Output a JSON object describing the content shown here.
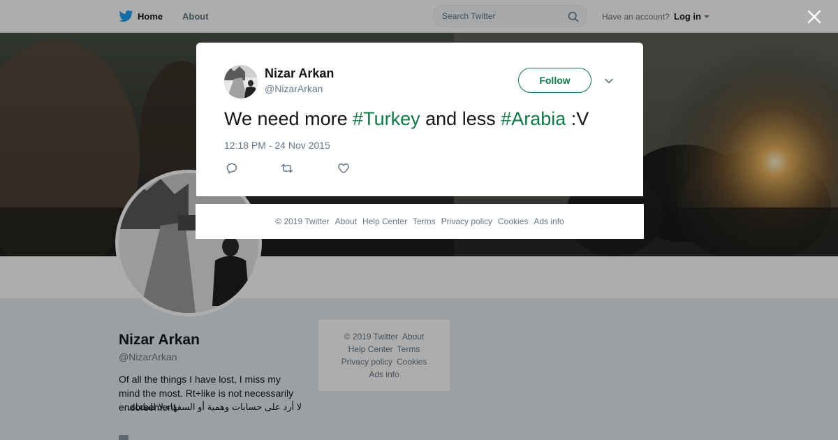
{
  "nav": {
    "home_label": "Home",
    "about_label": "About",
    "search_placeholder": "Search Twitter",
    "have_account": "Have an account?",
    "login_label": "Log in"
  },
  "profile": {
    "name": "Nizar Arkan",
    "handle": "@NizarArkan",
    "bio": "Of all the things I have lost, I miss my mind the most. Rt+like is not necessarily endorsement.",
    "bio_arabic": "لا أرد على حسابات وهمية أو السفهاء.لا للطغاة."
  },
  "side_footer": {
    "copyright": "© 2019 Twitter",
    "about": "About",
    "help_center": "Help Center",
    "terms": "Terms",
    "privacy": "Privacy policy",
    "cookies": "Cookies",
    "ads_info": "Ads info"
  },
  "tweet": {
    "author_name": "Nizar Arkan",
    "author_handle": "@NizarArkan",
    "follow_label": "Follow",
    "text_part1": "We need more ",
    "hashtag1": "#Turkey",
    "text_part2": " and less ",
    "hashtag2": "#Arabia",
    "text_part3": " :V",
    "timestamp": "12:18 PM - 24 Nov 2015"
  },
  "modal_footer": {
    "copyright": "© 2019 Twitter",
    "about": "About",
    "help_center": "Help Center",
    "terms": "Terms",
    "privacy": "Privacy policy",
    "cookies": "Cookies",
    "ads_info": "Ads info"
  },
  "icons": {
    "brand": "twitter-bird-icon",
    "search": "search-icon",
    "close": "close-icon",
    "caret": "chevron-down-icon",
    "reply": "reply-icon",
    "retweet": "retweet-icon",
    "like": "heart-icon"
  },
  "colors": {
    "brand_blue": "#1da1f2",
    "accent_green": "#0c7b48",
    "muted_text": "#657786"
  }
}
